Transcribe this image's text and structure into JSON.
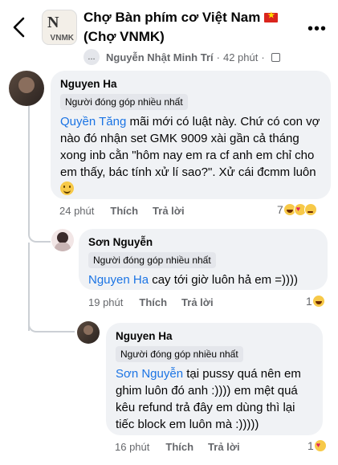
{
  "header": {
    "title_line1": "Chợ Bàn phím cơ Việt Nam",
    "title_line2": "(Chợ VNMK)",
    "post_author": "Nguyễn Nhật Minh Trí",
    "post_time": "42 phút",
    "sub_dots": "...",
    "flag": "vietnam-flag"
  },
  "comments": [
    {
      "author": "Nguyen Ha",
      "badge": "Người đóng góp nhiều nhất",
      "mention": "Quyền Tăng",
      "text": " mãi mới có luật này. Chứ có con vợ nào đó nhận set GMK 9009 xài gần cả tháng xong inb cằn \"hôm nay em ra cf anh em chỉ cho em thấy, bác tính xử lí sao?\". Xử cái đcmm luôn ",
      "time": "24 phút",
      "like": "Thích",
      "reply": "Trả lời",
      "reaction_count": "7",
      "reactions": [
        "laugh",
        "love",
        "cry"
      ]
    },
    {
      "author": "Sơn Nguyễn",
      "badge": "Người đóng góp nhiều nhất",
      "mention": "Nguyen Ha",
      "text": " cay tới giờ luôn hả em =))))",
      "time": "19 phút",
      "like": "Thích",
      "reply": "Trả lời",
      "reaction_count": "1",
      "reactions": [
        "laugh"
      ]
    },
    {
      "author": "Nguyen Ha",
      "badge": "Người đóng góp nhiều nhất",
      "mention": "Sơn Nguyễn",
      "text": " tại pussy quá nên em ghim luôn đó anh :)))) em mệt quá kêu refund trả đây em dùng thì lại tiếc block em luôn mà :)))))",
      "time": "16 phút",
      "like": "Thích",
      "reply": "Trả lời",
      "reaction_count": "1",
      "reactions": [
        "love"
      ]
    }
  ],
  "colors": {
    "mention": "#1b74e4",
    "bubble": "#f0f2f5",
    "meta": "#65676b"
  }
}
